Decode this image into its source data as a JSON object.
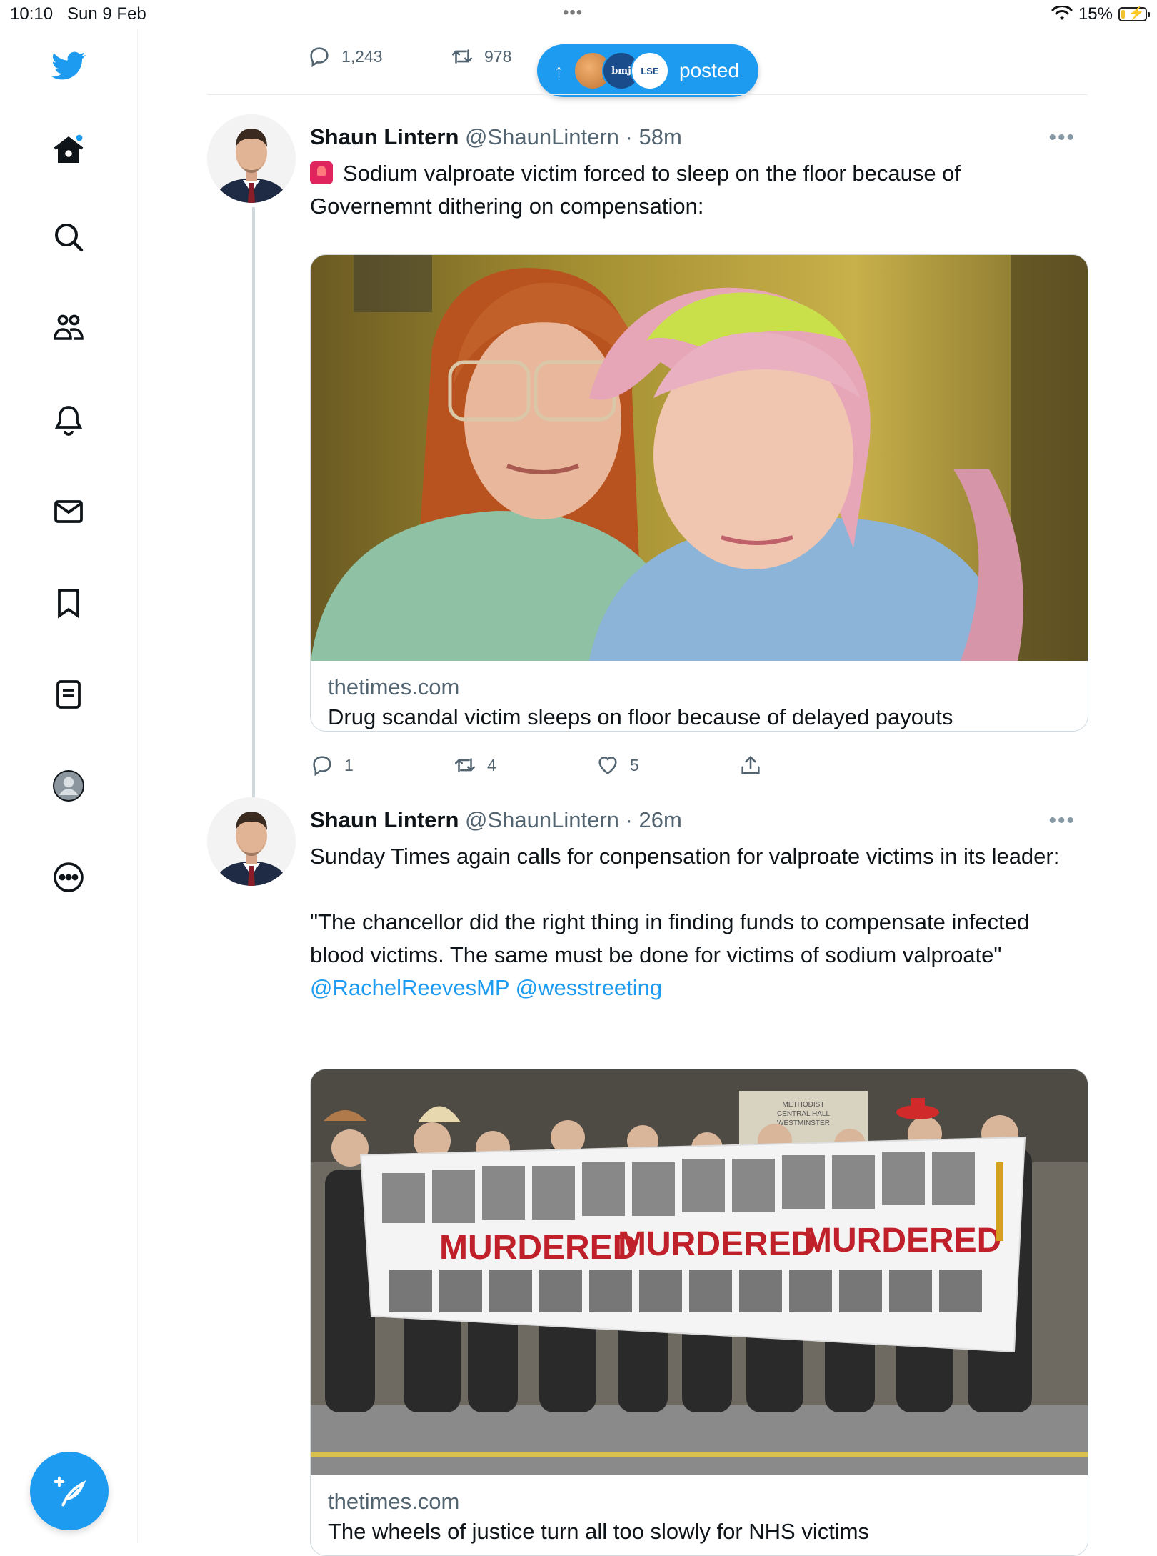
{
  "status_bar": {
    "time": "10:10",
    "date": "Sun 9 Feb",
    "battery": "15%",
    "battery_level": 0.15
  },
  "sidebar": {
    "items": [
      {
        "icon": "twitter-bird-icon"
      },
      {
        "icon": "home-icon",
        "has_notification_dot": true
      },
      {
        "icon": "search-icon"
      },
      {
        "icon": "communities-icon"
      },
      {
        "icon": "notifications-bell-icon"
      },
      {
        "icon": "messages-mail-icon"
      },
      {
        "icon": "bookmark-icon"
      },
      {
        "icon": "lists-icon"
      },
      {
        "icon": "profile-icon"
      },
      {
        "icon": "more-options-icon"
      }
    ],
    "compose_icon": "compose-feather-icon"
  },
  "previous_tweet": {
    "replies": "1,243",
    "retweets": "978"
  },
  "new_posts_pill": {
    "label": "posted",
    "avatars": [
      "",
      "bmj",
      "LSE"
    ]
  },
  "tweets": [
    {
      "display_name": "Shaun Lintern",
      "handle": "@ShaunLintern",
      "separator": "·",
      "time": "58m",
      "text": "Sodium valproate victim forced to sleep on the floor because of Governemnt dithering on compensation:",
      "card": {
        "domain": "thetimes.com",
        "title": "Drug scandal victim sleeps on floor because of delayed payouts"
      },
      "replies": "1",
      "retweets": "4",
      "likes": "5"
    },
    {
      "display_name": "Shaun Lintern",
      "handle": "@ShaunLintern",
      "separator": "·",
      "time": "26m",
      "text_line1": "Sunday Times again calls for conpensation for valproate victims in its leader:",
      "text_quote": "\"The chancellor did the right thing in finding funds to compensate infected blood victims. The same must be done for victims of sodium valproate\"",
      "mention1": "@RachelReevesMP",
      "mention2": "@wesstreeting",
      "card": {
        "domain": "thetimes.com",
        "title": "The wheels of justice turn all too slowly for NHS victims",
        "banner_word": "MURDERED",
        "venue_sign": "METHODIST CENTRAL HALL WESTMINSTER"
      }
    }
  ],
  "colors": {
    "brand": "#1d9bf0",
    "text": "#0f1419",
    "secondary": "#536471",
    "border": "#cfd9de"
  }
}
